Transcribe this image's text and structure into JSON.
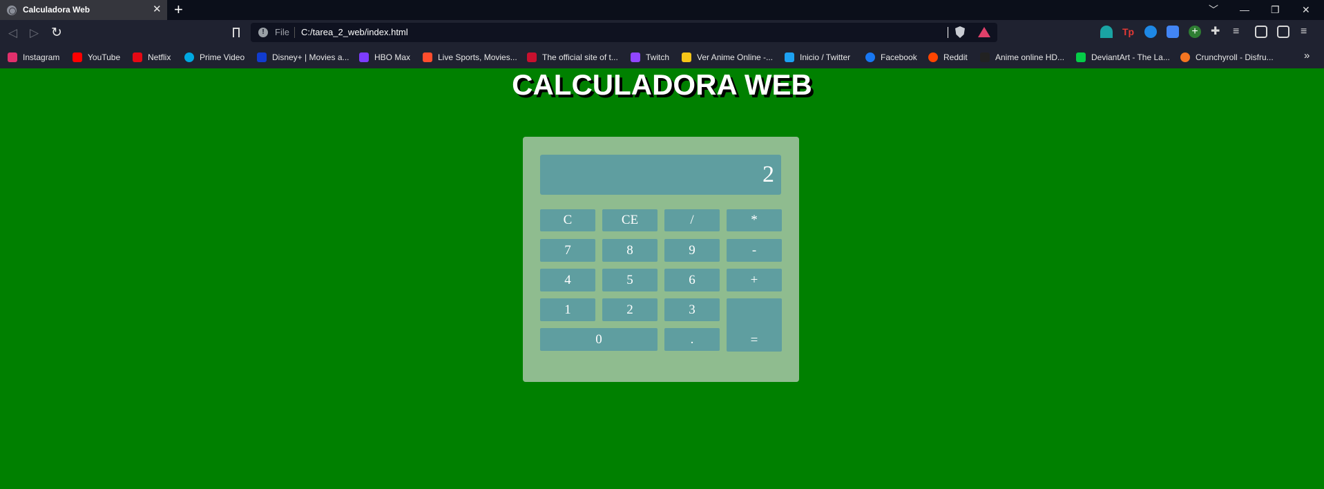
{
  "browser": {
    "tab_title": "Calculadora Web",
    "tab_close": "✕",
    "new_tab": "+",
    "window_controls": [
      "﹀",
      "—",
      "❐",
      "✕"
    ],
    "file_label": "File",
    "url": "C:/tarea_2_web/index.html"
  },
  "bookmarks": [
    {
      "label": "Instagram",
      "color": "#e1306c"
    },
    {
      "label": "YouTube",
      "color": "#ff0000"
    },
    {
      "label": "Netflix",
      "color": "#e50914"
    },
    {
      "label": "Prime Video",
      "color": "#00a8e1"
    },
    {
      "label": "Disney+ | Movies a...",
      "color": "#113ccf"
    },
    {
      "label": "HBO Max",
      "color": "#7d3cff"
    },
    {
      "label": "Live Sports, Movies...",
      "color": "#ff4d2d"
    },
    {
      "label": "The official site of t...",
      "color": "#c8102e"
    },
    {
      "label": "Twitch",
      "color": "#9146ff"
    },
    {
      "label": "Ver Anime Online -...",
      "color": "#f5c518"
    },
    {
      "label": "Inicio / Twitter",
      "color": "#1da1f2"
    },
    {
      "label": "Facebook",
      "color": "#1877f2"
    },
    {
      "label": "Reddit",
      "color": "#ff4500"
    },
    {
      "label": "Anime online HD...",
      "color": "#222222"
    },
    {
      "label": "DeviantArt - The La...",
      "color": "#05cc47"
    },
    {
      "label": "Crunchyroll - Disfru...",
      "color": "#f47521"
    }
  ],
  "bookmarks_more": "»",
  "page": {
    "title": "CALCULADORA WEB"
  },
  "calculator": {
    "display": "2",
    "keys": {
      "clear": "C",
      "clear_entry": "CE",
      "divide": "/",
      "multiply": "*",
      "seven": "7",
      "eight": "8",
      "nine": "9",
      "minus": "-",
      "four": "4",
      "five": "5",
      "six": "6",
      "plus": "+",
      "one": "1",
      "two": "2",
      "three": "3",
      "equals": "=",
      "zero": "0",
      "decimal": "."
    }
  },
  "colors": {
    "page_background": "#008000",
    "calculator_body": "#8fbc8f",
    "keys_and_display": "#5f9ea0"
  }
}
